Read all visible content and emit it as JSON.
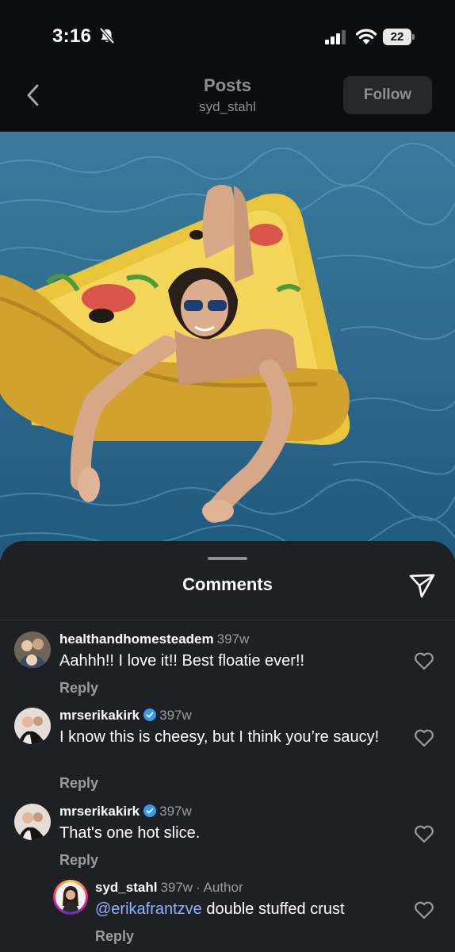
{
  "status_bar": {
    "time": "3:16",
    "battery": "22"
  },
  "header": {
    "title": "Posts",
    "username": "syd_stahl",
    "follow_label": "Follow"
  },
  "comments_sheet": {
    "title": "Comments",
    "comments": [
      {
        "username": "healthandhomesteadem",
        "time": "397w",
        "text": "Aahhh!! I love it!! Best floatie ever!!",
        "reply_label": "Reply"
      },
      {
        "username": "mrserikakirk",
        "verified": true,
        "time": "397w",
        "text": "I know this is cheesy, but I think you’re saucy!",
        "reply_label": "Reply"
      },
      {
        "username": "mrserikakirk",
        "verified": true,
        "time": "397w",
        "text": "That's one hot slice.",
        "reply_label": "Reply"
      },
      {
        "username": "syd_stahl",
        "time": "397w",
        "author_label": "· Author",
        "mention": "@erikafrantzve",
        "text": " double stuffed crust",
        "reply_label": "Reply"
      }
    ]
  }
}
